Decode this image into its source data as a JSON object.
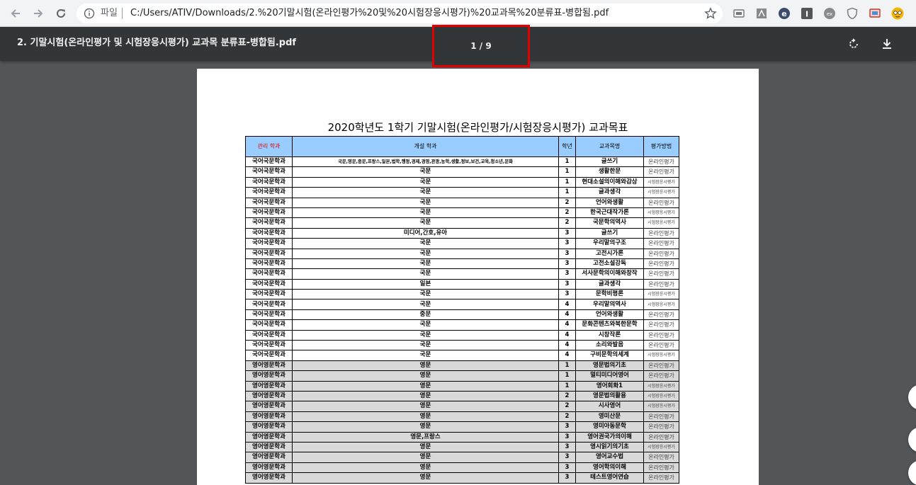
{
  "browser": {
    "scheme_label": "파일",
    "url": "C:/Users/ATIV/Downloads/2.%20기말시험(온라인평가%20및%20시험장응시평가)%20교과목%20분류표-병합됨.pdf",
    "icons": [
      "back-icon",
      "forward-icon",
      "reload-icon",
      "info-icon",
      "star-icon"
    ],
    "extensions": [
      "extension-1-icon",
      "pdf-extension-icon",
      "extension-e-icon",
      "extension-i-icon",
      "extension-ex-icon",
      "shield-extension-icon",
      "cast-extension-icon",
      "profile-avatar-icon"
    ]
  },
  "viewer": {
    "title": "2. 기말시험(온라인평가 및 시험장응시평가) 교과목 분류표-병합됨.pdf",
    "page_indicator": "1 / 9",
    "highlight_color": "#e50000"
  },
  "document": {
    "title": "2020학년도 1학기 기말시험(온라인평가/시험장응시평가) 교과목표",
    "headers": {
      "dept": "관리 학과",
      "open": "개설 학과",
      "year": "학년",
      "subject": "교과목명",
      "method": "평가방법"
    },
    "rows": [
      {
        "dept": "국어국문학과",
        "open": "국문,영문,중문,프랑스,일본,법학,행정,경제,경영,관광,농학,생활,정보,보건,교육,청소년,문화",
        "year": "1",
        "subject": "글쓰기",
        "method": "온라인평가"
      },
      {
        "dept": "국어국문학과",
        "open": "국문",
        "year": "1",
        "subject": "생활한문",
        "method": "온라인평가"
      },
      {
        "dept": "국어국문학과",
        "open": "국문",
        "year": "1",
        "subject": "현대소설의이해와감상",
        "method": "시험장응시평가"
      },
      {
        "dept": "국어국문학과",
        "open": "국문",
        "year": "1",
        "subject": "글과생각",
        "method": "시험장응시평가"
      },
      {
        "dept": "국어국문학과",
        "open": "국문",
        "year": "2",
        "subject": "언어와생활",
        "method": "온라인평가"
      },
      {
        "dept": "국어국문학과",
        "open": "국문",
        "year": "2",
        "subject": "한국근대작가론",
        "method": "시험장응시평가"
      },
      {
        "dept": "국어국문학과",
        "open": "국문",
        "year": "2",
        "subject": "국문학의역사",
        "method": "시험장응시평가"
      },
      {
        "dept": "국어국문학과",
        "open": "미디어,간호,유아",
        "year": "3",
        "subject": "글쓰기",
        "method": "온라인평가"
      },
      {
        "dept": "국어국문학과",
        "open": "국문",
        "year": "3",
        "subject": "우리말의구조",
        "method": "온라인평가"
      },
      {
        "dept": "국어국문학과",
        "open": "국문",
        "year": "3",
        "subject": "고전시가론",
        "method": "온라인평가"
      },
      {
        "dept": "국어국문학과",
        "open": "국문",
        "year": "3",
        "subject": "고전소설강독",
        "method": "온라인평가"
      },
      {
        "dept": "국어국문학과",
        "open": "국문",
        "year": "3",
        "subject": "서사문학의이해와창작",
        "method": "온라인평가"
      },
      {
        "dept": "국어국문학과",
        "open": "일본",
        "year": "3",
        "subject": "글과생각",
        "method": "온라인평가"
      },
      {
        "dept": "국어국문학과",
        "open": "국문",
        "year": "3",
        "subject": "문학비평론",
        "method": "시험장응시평가"
      },
      {
        "dept": "국어국문학과",
        "open": "국문",
        "year": "4",
        "subject": "우리말의역사",
        "method": "시험장응시평가"
      },
      {
        "dept": "국어국문학과",
        "open": "중문",
        "year": "4",
        "subject": "언어와생활",
        "method": "온라인평가"
      },
      {
        "dept": "국어국문학과",
        "open": "국문",
        "year": "4",
        "subject": "문화콘텐츠와북한문학",
        "method": "온라인평가"
      },
      {
        "dept": "국어국문학과",
        "open": "국문",
        "year": "4",
        "subject": "시창작론",
        "method": "온라인평가"
      },
      {
        "dept": "국어국문학과",
        "open": "국문",
        "year": "4",
        "subject": "소리와발음",
        "method": "온라인평가"
      },
      {
        "dept": "국어국문학과",
        "open": "국문",
        "year": "4",
        "subject": "구비문학의세계",
        "method": "시험장응시평가"
      },
      {
        "dept": "영어영문학과",
        "open": "영문",
        "year": "1",
        "subject": "영문법의기초",
        "method": "온라인평가"
      },
      {
        "dept": "영어영문학과",
        "open": "영문",
        "year": "1",
        "subject": "멀티미디어영어",
        "method": "온라인평가"
      },
      {
        "dept": "영어영문학과",
        "open": "영문",
        "year": "1",
        "subject": "영어회화1",
        "method": "시험장응시평가"
      },
      {
        "dept": "영어영문학과",
        "open": "영문",
        "year": "2",
        "subject": "영문법의활용",
        "method": "시험장응시평가"
      },
      {
        "dept": "영어영문학과",
        "open": "영문",
        "year": "2",
        "subject": "시사영어",
        "method": "시험장응시평가"
      },
      {
        "dept": "영어영문학과",
        "open": "영문",
        "year": "2",
        "subject": "영미산문",
        "method": "온라인평가"
      },
      {
        "dept": "영어영문학과",
        "open": "영문",
        "year": "3",
        "subject": "영미아동문학",
        "method": "온라인평가"
      },
      {
        "dept": "영어영문학과",
        "open": "영문,프랑스",
        "year": "3",
        "subject": "영어권국가의이해",
        "method": "온라인평가"
      },
      {
        "dept": "영어영문학과",
        "open": "영문",
        "year": "3",
        "subject": "영시읽기의기초",
        "method": "시험장응시평가"
      },
      {
        "dept": "영어영문학과",
        "open": "영문",
        "year": "3",
        "subject": "영어교수법",
        "method": "온라인평가"
      },
      {
        "dept": "영어영문학과",
        "open": "영문",
        "year": "3",
        "subject": "영어학의이해",
        "method": "온라인평가"
      },
      {
        "dept": "영어영문학과",
        "open": "영문",
        "year": "3",
        "subject": "테스트영어연습",
        "method": "온라인평가"
      }
    ]
  }
}
